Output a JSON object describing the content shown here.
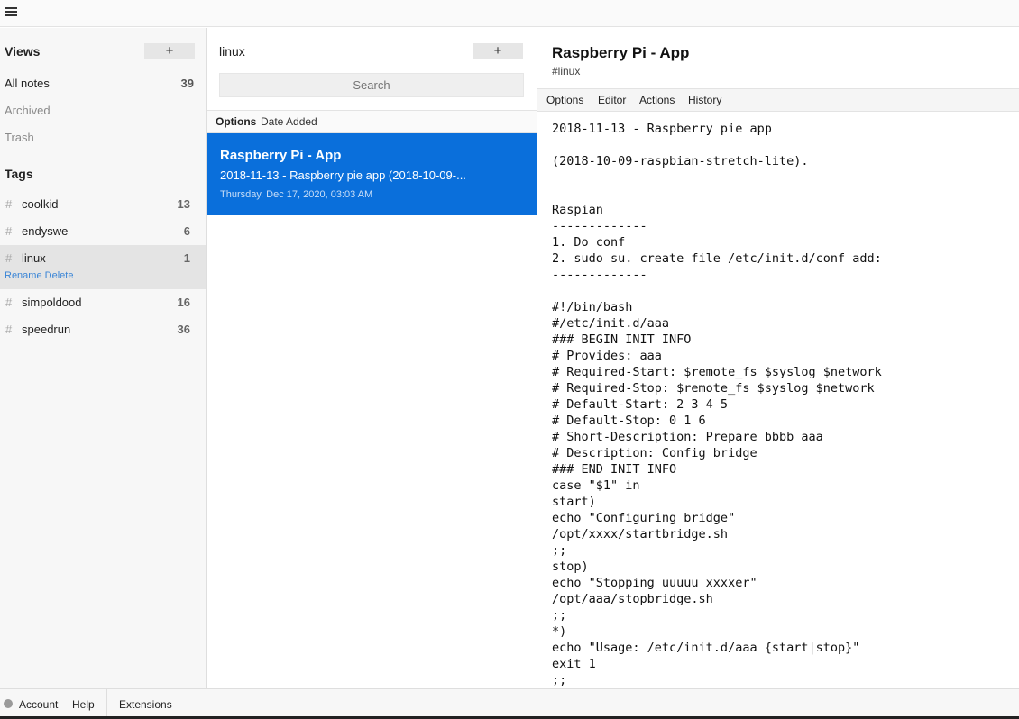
{
  "views": {
    "header": "Views",
    "add_label": "+",
    "items": [
      {
        "label": "All notes",
        "count": "39"
      },
      {
        "label": "Archived"
      },
      {
        "label": "Trash"
      }
    ]
  },
  "tags": {
    "header": "Tags",
    "hash": "#",
    "items": [
      {
        "label": "coolkid",
        "count": "13"
      },
      {
        "label": "endyswe",
        "count": "6"
      },
      {
        "label": "linux",
        "count": "1"
      },
      {
        "label": "simpoldood",
        "count": "16"
      },
      {
        "label": "speedrun",
        "count": "36"
      }
    ],
    "rename_label": "Rename",
    "delete_label": "Delete"
  },
  "notes": {
    "title": "linux",
    "add_label": "+",
    "search_placeholder": "Search",
    "options_label": "Options",
    "sort_label": "Date Added",
    "items": [
      {
        "title": "Raspberry Pi - App",
        "preview": "2018-11-13 - Raspberry pie app (2018-10-09-...",
        "date": "Thursday, Dec 17, 2020, 03:03 AM"
      }
    ]
  },
  "editor": {
    "title": "Raspberry Pi - App",
    "tag": "#linux",
    "menu": [
      "Options",
      "Editor",
      "Actions",
      "History"
    ],
    "text": "2018-11-13 - Raspberry pie app\n\n(2018-10-09-raspbian-stretch-lite).\n\n\nRaspian\n-------------\n1. Do conf\n2. sudo su. create file /etc/init.d/conf add:\n-------------\n\n#!/bin/bash\n#/etc/init.d/aaa\n### BEGIN INIT INFO\n# Provides: aaa\n# Required-Start: $remote_fs $syslog $network\n# Required-Stop: $remote_fs $syslog $network\n# Default-Start: 2 3 4 5\n# Default-Stop: 0 1 6\n# Short-Description: Prepare bbbb aaa\n# Description: Config bridge\n### END INIT INFO\ncase \"$1\" in\nstart)\necho \"Configuring bridge\"\n/opt/xxxx/startbridge.sh\n;;\nstop)\necho \"Stopping uuuuu xxxxer\"\n/opt/aaa/stopbridge.sh\n;;\n*)\necho \"Usage: /etc/init.d/aaa {start|stop}\"\nexit 1\n;;"
  },
  "footer": {
    "account_label": "Account",
    "help_label": "Help",
    "extensions_label": "Extensions"
  },
  "colors": {
    "accent": "#0a6fdb",
    "link": "#3a85d6"
  }
}
